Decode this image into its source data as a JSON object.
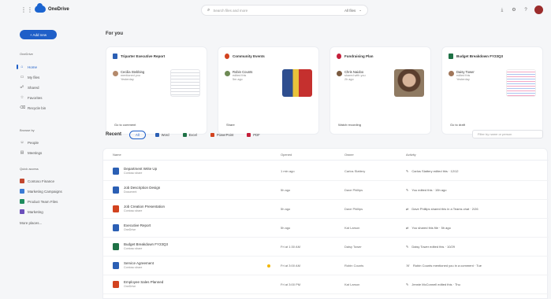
{
  "app": {
    "name": "OneDrive"
  },
  "search": {
    "placeholder": "Search files and more",
    "filter": "All files"
  },
  "sidebar": {
    "add_new": "+ Add new",
    "section_onedrive": "OneDrive",
    "items": [
      {
        "label": "Home",
        "icon": "home-icon",
        "glyph": "⌂"
      },
      {
        "label": "My files",
        "icon": "folder-icon",
        "glyph": "▭"
      },
      {
        "label": "Shared",
        "icon": "people-icon",
        "glyph": "☍"
      },
      {
        "label": "Favorites",
        "icon": "star-icon",
        "glyph": "☆"
      },
      {
        "label": "Recycle bin",
        "icon": "trash-icon",
        "glyph": "⌫"
      }
    ],
    "section_browse": "Browse by",
    "browse": [
      {
        "label": "People",
        "glyph": "☺"
      },
      {
        "label": "Meetings",
        "glyph": "▤"
      }
    ],
    "section_quick": "Quick access",
    "quick": [
      {
        "label": "Contoso Finance",
        "color": "#c2462e"
      },
      {
        "label": "Marketing Campaigns",
        "color": "#3a7bd5"
      },
      {
        "label": "Product Team Files",
        "color": "#1e8c5e"
      },
      {
        "label": "Marketing",
        "color": "#6b4fbb"
      }
    ],
    "more_places": "More places..."
  },
  "foryou": {
    "title": "For you",
    "cards": [
      {
        "title": "Triparter Executive Report",
        "file_color": "#2b5fb4",
        "person": "Cecilia Stebbing",
        "sub": "mentioned you",
        "sub2": "Yesterday",
        "button": "Go to comment",
        "thumb": "doc"
      },
      {
        "title": "Community Events",
        "file_color": "#d2431f",
        "person": "Robin Counts",
        "sub": "edited this",
        "sub2": "5m ago",
        "button": "Share",
        "thumb": "poster"
      },
      {
        "title": "Fundraising Plan",
        "file_color": "#c41f3a",
        "person": "Chris Naidoo",
        "sub": "shared with you",
        "sub2": "2h ago",
        "button": "Watch recording",
        "thumb": "photo"
      },
      {
        "title": "Budget Breakdown FY23Q3",
        "file_color": "#1e7145",
        "person": "Daisy Tower",
        "sub": "edited this",
        "sub2": "Yesterday",
        "button": "Go to draft",
        "thumb": "sheet"
      }
    ]
  },
  "recent": {
    "title": "Recent",
    "filters": [
      {
        "label": "All",
        "color": ""
      },
      {
        "label": "Word",
        "color": "#2b5fb4"
      },
      {
        "label": "Excel",
        "color": "#1e7145"
      },
      {
        "label": "PowerPoint",
        "color": "#d2431f"
      },
      {
        "label": "PDF",
        "color": "#c41f3a"
      }
    ],
    "filter_placeholder": "Filter by name or person",
    "columns": {
      "name": "Name",
      "opened": "Opened",
      "owner": "Owner",
      "activity": "Activity"
    },
    "rows": [
      {
        "name": "Department Write Up",
        "sub": "Contoso share",
        "opened": "1 min ago",
        "owner": "Carlos Slattery",
        "activity": "Carlos Slattery edited this · 12/12",
        "color": "#2b5fb4",
        "act_icon": "✎",
        "starred": false
      },
      {
        "name": "Job Description Design",
        "sub": "Document",
        "opened": "5h ago",
        "owner": "Dave Phillips",
        "activity": "You edited this · 15h ago",
        "color": "#2b5fb4",
        "act_icon": "✎",
        "starred": false
      },
      {
        "name": "Job Creation Presentation",
        "sub": "Contoso share",
        "opened": "5h ago",
        "owner": "Dave Phillips",
        "activity": "Dave Phillips shared this in a Teams chat · 2/26",
        "color": "#d2431f",
        "act_icon": "⇄",
        "starred": false
      },
      {
        "name": "Executive Report",
        "sub": "OneDrive",
        "opened": "5h ago",
        "owner": "Kat Larson",
        "activity": "You shared this file · 5h ago",
        "color": "#2b5fb4",
        "act_icon": "⇄",
        "starred": false
      },
      {
        "name": "Budget Breakdown FY23Q3",
        "sub": "Contoso share",
        "opened": "Fri at 1:30 AM",
        "owner": "Daisy Tower",
        "activity": "Daisy Tower edited this · 10/29",
        "color": "#1e7145",
        "act_icon": "✎",
        "starred": false
      },
      {
        "name": "Service Agreement",
        "sub": "Contoso share",
        "opened": "Fri at 3:00 AM",
        "owner": "Robin Counts",
        "activity": "Robin Counts mentioned you in a comment · Tue",
        "color": "#2b5fb4",
        "act_icon": "☏",
        "starred": true
      },
      {
        "name": "Employee Sales Planned",
        "sub": "OneDrive",
        "opened": "Fri at 3:00 PM",
        "owner": "Kat Larson",
        "activity": "Jennie McConnell edited this · Thu",
        "color": "#d2431f",
        "act_icon": "✎",
        "starred": false
      }
    ]
  }
}
